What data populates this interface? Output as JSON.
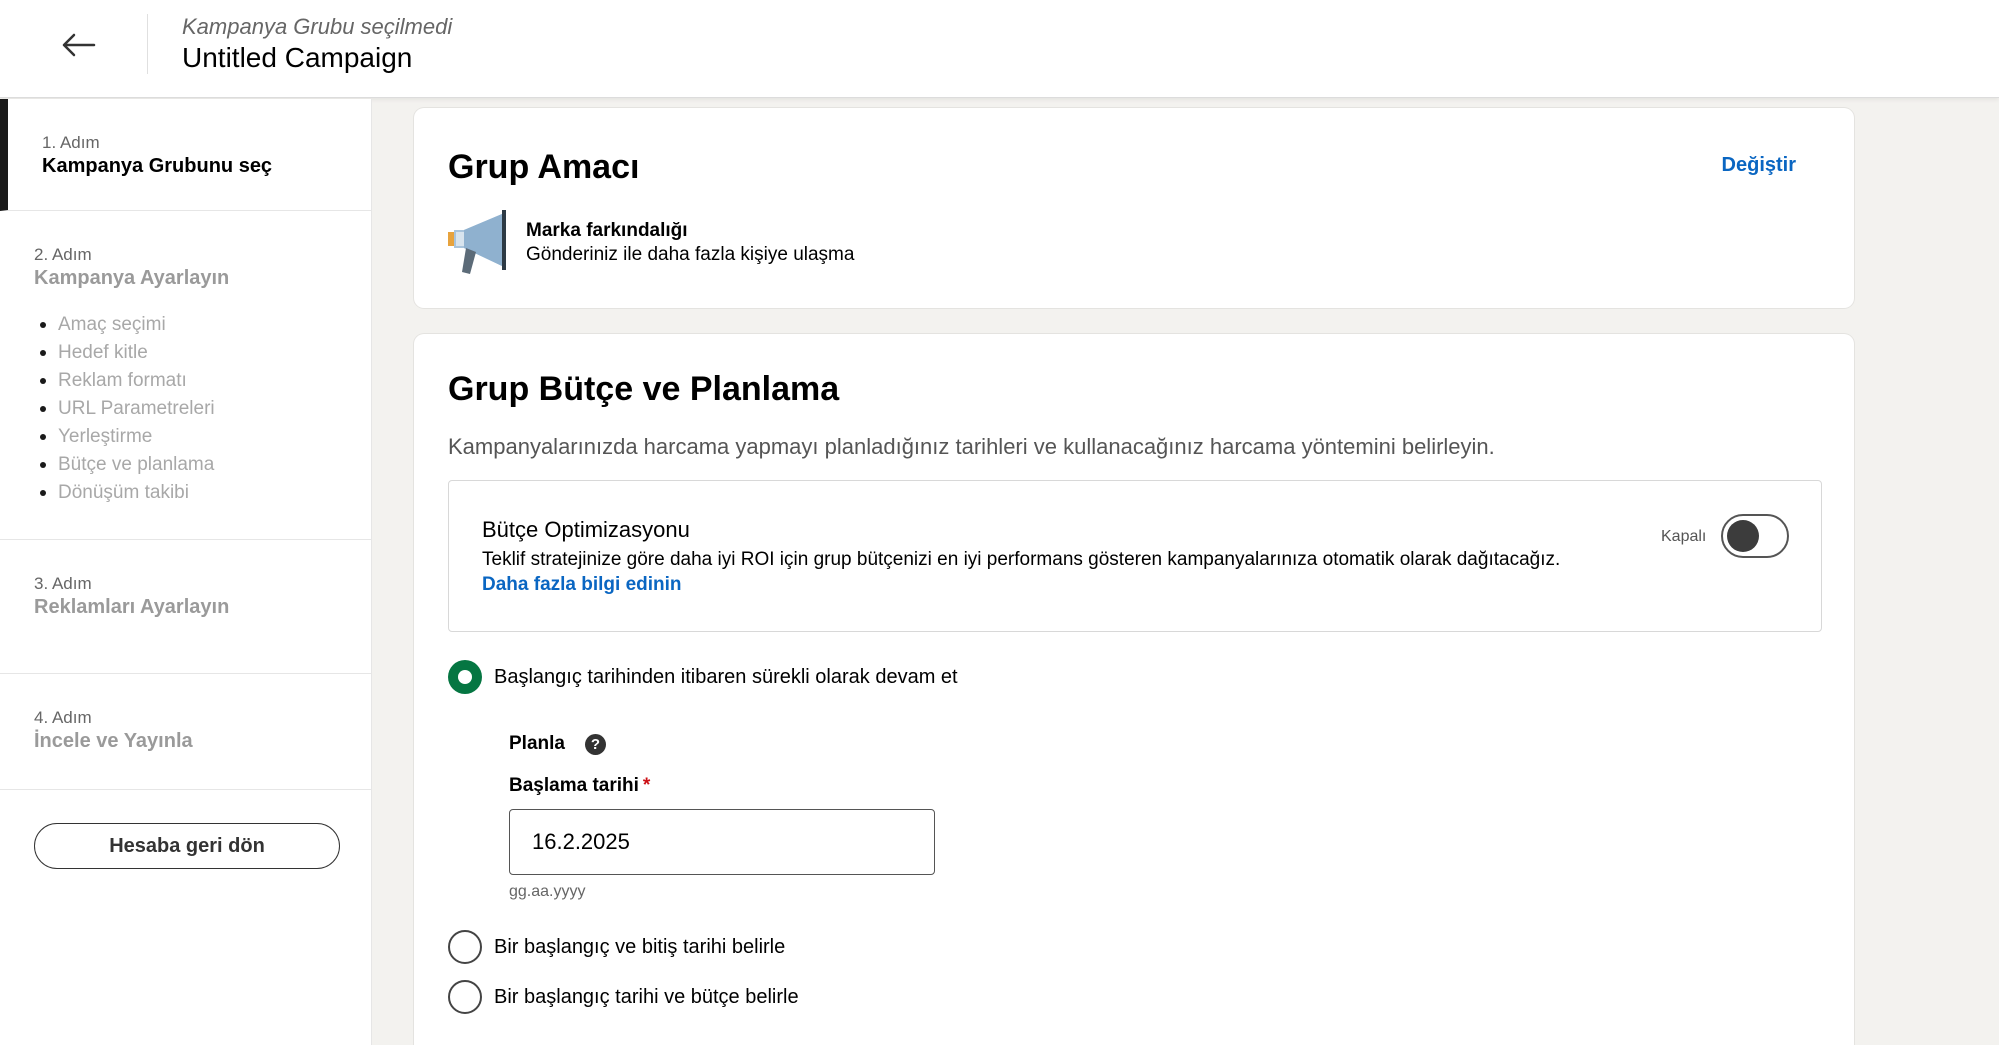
{
  "header": {
    "subtitle": "Kampanya Grubu seçilmedi",
    "title": "Untitled Campaign"
  },
  "sidebar": {
    "steps": [
      {
        "num": "1. Adım",
        "title": "Kampanya Grubunu seç"
      },
      {
        "num": "2. Adım",
        "title": "Kampanya Ayarlayın"
      },
      {
        "num": "3. Adım",
        "title": "Reklamları Ayarlayın"
      },
      {
        "num": "4. Adım",
        "title": "İncele ve Yayınla"
      }
    ],
    "substeps": [
      "Amaç seçimi",
      "Hedef kitle",
      "Reklam formatı",
      "URL Parametreleri",
      "Yerleştirme",
      "Bütçe ve planlama",
      "Dönüşüm takibi"
    ],
    "back_button": "Hesaba geri dön"
  },
  "objective_card": {
    "title": "Grup Amacı",
    "change_label": "Değiştir",
    "objective_name": "Marka farkındalığı",
    "objective_desc": "Gönderiniz ile daha fazla kişiye ulaşma",
    "icon": "megaphone-icon"
  },
  "budget_card": {
    "title": "Grup Bütçe ve Planlama",
    "description": "Kampanyalarınızda harcama yapmayı planladığınız tarihleri ve kullanacağınız harcama yöntemini belirleyin.",
    "optimization": {
      "title": "Bütçe Optimizasyonu",
      "description": "Teklif stratejinize göre daha iyi ROI için grup bütçenizi en iyi performans gösteren kampanyalarınıza otomatik olarak dağıtacağız.",
      "link": "Daha fazla bilgi edinin",
      "toggle_label": "Kapalı"
    },
    "options": [
      "Başlangıç tarihinden itibaren sürekli olarak devam et",
      "Bir başlangıç ve bitiş tarihi belirle",
      "Bir başlangıç tarihi ve bütçe belirle"
    ],
    "schedule_label": "Planla",
    "start_date_label": "Başlama tarihi",
    "required_mark": "*",
    "start_date_value": "16.2.2025",
    "date_format_hint": "gg.aa.yyyy"
  },
  "colors": {
    "accent_link": "#0a66c2",
    "radio_selected": "#057642",
    "required": "#cc1016"
  }
}
